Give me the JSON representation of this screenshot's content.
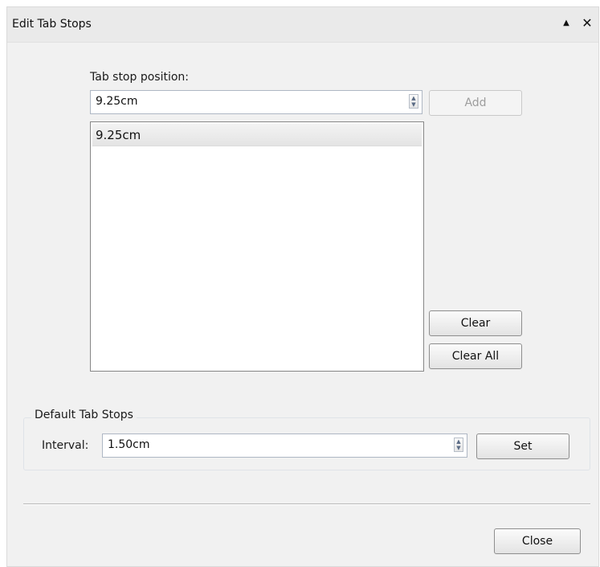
{
  "window": {
    "title": "Edit Tab Stops",
    "collapse_glyph": "▲",
    "close_glyph": "✕"
  },
  "tab_stop": {
    "position_label": "Tab stop position:",
    "position_value": "9.25cm",
    "add_label": "Add",
    "list_items": [
      "9.25cm"
    ],
    "clear_label": "Clear",
    "clear_all_label": "Clear All"
  },
  "default_tab_stops": {
    "group_title": "Default Tab Stops",
    "interval_label": "Interval:",
    "interval_value": "1.50cm",
    "set_label": "Set"
  },
  "footer": {
    "close_label": "Close"
  }
}
